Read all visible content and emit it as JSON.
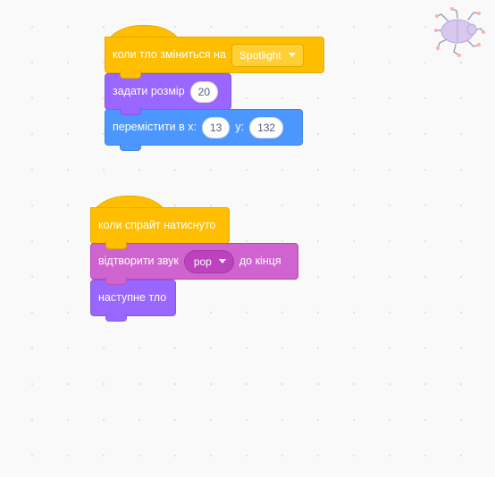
{
  "scripts": [
    {
      "hat": {
        "label": "коли тло зміниться на",
        "dropdown": "Spotlight"
      },
      "blocks": [
        {
          "label": "задати розмір",
          "value": "20"
        },
        {
          "label": "перемістити в x:",
          "x_value": "13",
          "y_label": "y:",
          "y_value": "132"
        }
      ]
    },
    {
      "hat": {
        "label": "коли спрайт натиснуто"
      },
      "blocks": [
        {
          "label_before": "відтворити звук",
          "dropdown": "pop",
          "label_after": "до кінця"
        },
        {
          "label": "наступне тло"
        }
      ]
    }
  ],
  "sprite": {
    "icon": "beetle-icon"
  },
  "colors": {
    "events": "#ffbf00",
    "looks": "#9966ff",
    "motion": "#4c97ff",
    "sound": "#cf63cf",
    "canvas": "#f9f9f9"
  }
}
